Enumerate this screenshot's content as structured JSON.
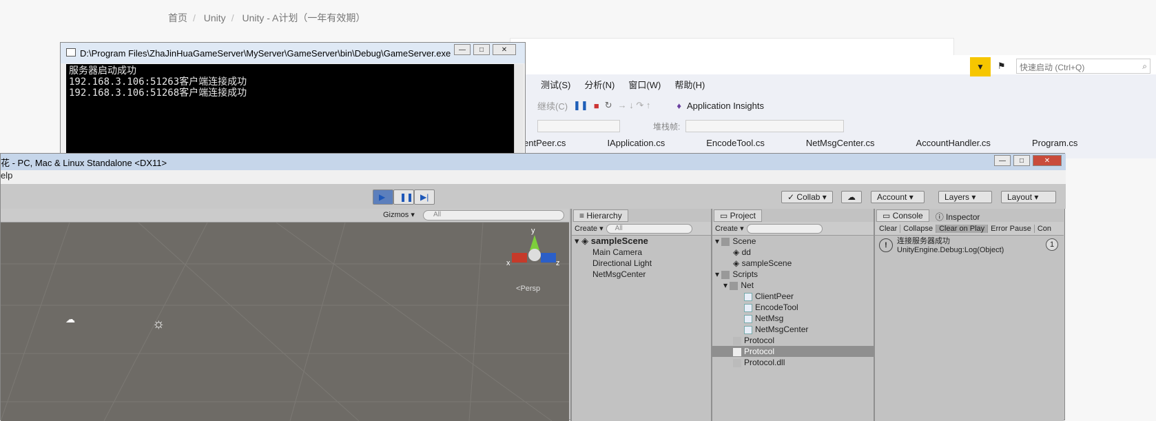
{
  "web": {
    "breadcrumb": [
      "首页",
      "Unity",
      "Unity - A计划（一年有效期）"
    ]
  },
  "vs": {
    "menu": [
      "测试(S)",
      "分析(N)",
      "窗口(W)",
      "帮助(H)"
    ],
    "continue_label": "继续(C)",
    "app_insights": "Application Insights",
    "stack_frame_label": "堆栈帧:",
    "quick_launch_placeholder": "快速启动 (Ctrl+Q)",
    "tabs": [
      "entPeer.cs",
      "IApplication.cs",
      "EncodeTool.cs",
      "NetMsgCenter.cs",
      "AccountHandler.cs",
      "Program.cs"
    ]
  },
  "console": {
    "title": "D:\\Program Files\\ZhaJinHuaGameServer\\MyServer\\GameServer\\bin\\Debug\\GameServer.exe",
    "lines": [
      "服务器启动成功",
      "192.168.3.106:51263客户端连接成功",
      "192.168.3.106:51268客户端连接成功"
    ]
  },
  "unity": {
    "title": "花 - PC, Mac & Linux Standalone <DX11>",
    "menu_help": "elp",
    "collab": "Collab",
    "account": "Account",
    "layers": "Layers",
    "layout": "Layout",
    "gizmos": "Gizmos",
    "search_all": "All",
    "persp": "Persp",
    "axis": {
      "x": "x",
      "y": "y",
      "z": "z"
    },
    "hierarchy": {
      "tab": "Hierarchy",
      "create": "Create",
      "search": "All",
      "scene": "sampleScene",
      "items": [
        "Main Camera",
        "Directional Light",
        "NetMsgCenter"
      ]
    },
    "project": {
      "tab": "Project",
      "create": "Create",
      "items": [
        "Scene",
        "dd",
        "sampleScene",
        "Scripts",
        "Net",
        "ClientPeer",
        "EncodeTool",
        "NetMsg",
        "NetMsgCenter",
        "Protocol",
        "Protocol",
        "Protocol.dll"
      ]
    },
    "console": {
      "tab": "Console",
      "inspector_tab": "Inspector",
      "buttons": [
        "Clear",
        "Collapse",
        "Clear on Play",
        "Error Pause",
        "Con"
      ],
      "log_line1": "连接服务器成功",
      "log_line2": "UnityEngine.Debug:Log(Object)",
      "log_count": "1"
    }
  }
}
